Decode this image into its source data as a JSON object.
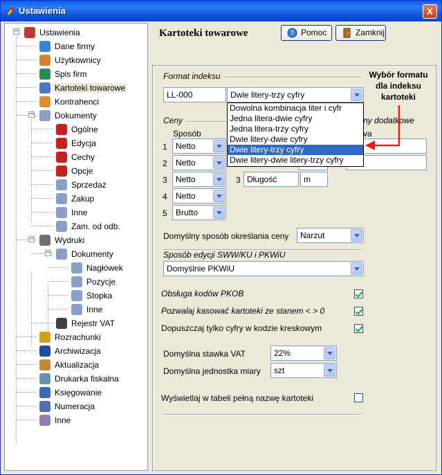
{
  "window": {
    "title": "Ustawienia",
    "close_label": "X"
  },
  "tree": [
    {
      "label": "Ustawienia",
      "icon": "tools-icon"
    },
    {
      "label": "Dane firmy",
      "icon": "building-icon"
    },
    {
      "label": "Użytkownicy",
      "icon": "users-icon"
    },
    {
      "label": "Spis firm",
      "icon": "books-icon"
    },
    {
      "label": "Kartoteki towarowe",
      "icon": "cabinet-icon"
    },
    {
      "label": "Kontrahenci",
      "icon": "handshake-icon"
    },
    {
      "label": "Dokumenty",
      "icon": "documents-icon"
    },
    {
      "label": "Ogólne",
      "icon": "doc-red-icon"
    },
    {
      "label": "Edycja",
      "icon": "doc-red-icon"
    },
    {
      "label": "Cechy",
      "icon": "doc-red-icon"
    },
    {
      "label": "Opcje",
      "icon": "doc-red-icon"
    },
    {
      "label": "Sprzedaż",
      "icon": "documents-icon"
    },
    {
      "label": "Zakup",
      "icon": "documents-icon"
    },
    {
      "label": "Inne",
      "icon": "documents-icon"
    },
    {
      "label": "Zam. od odb.",
      "icon": "documents-icon"
    },
    {
      "label": "Wydruki",
      "icon": "printer-icon"
    },
    {
      "label": "Dokumenty",
      "icon": "documents-icon"
    },
    {
      "label": "Nagłówek",
      "icon": "documents-icon"
    },
    {
      "label": "Pozycje",
      "icon": "documents-icon"
    },
    {
      "label": "Stopka",
      "icon": "documents-icon"
    },
    {
      "label": "Inne",
      "icon": "documents-icon"
    },
    {
      "label": "Rejestr VAT",
      "icon": "vat-icon"
    },
    {
      "label": "Rozrachunki",
      "icon": "money-icon"
    },
    {
      "label": "Archiwizacja",
      "icon": "disk-icon"
    },
    {
      "label": "Aktualizacja",
      "icon": "box-icon"
    },
    {
      "label": "Drukarka fiskalna",
      "icon": "cash-register-icon"
    },
    {
      "label": "Księgowanie",
      "icon": "ledger-icon"
    },
    {
      "label": "Numeracja",
      "icon": "numbering-icon"
    },
    {
      "label": "Inne",
      "icon": "gears-icon"
    }
  ],
  "header": {
    "title": "Kartoteki towarowe",
    "help_label": "Pomoc",
    "close_label": "Zamknij"
  },
  "format": {
    "section_label": "Format indeksu",
    "index_value": "LL-000",
    "selected": "Dwie litery-trzy cyfry",
    "options": [
      "Dowolna kombinacja liter i cyfr",
      "Jedna litera-dwie cyfry",
      "Jedna litera-trzy cyfry",
      "Dwie litery-dwie cyfry",
      "Dwie litery-trzy cyfry",
      "Dwie litery-dwie litery-trzy cyfry"
    ],
    "active_option_index": 4
  },
  "annotation": {
    "line1": "Wybór formatu",
    "line2": "dla indeksu",
    "line3": "kartoteki"
  },
  "prices": {
    "section_label": "Ceny",
    "column_label": "Sposób",
    "rows": [
      {
        "num": "1",
        "value": "Netto"
      },
      {
        "num": "2",
        "value": "Netto"
      },
      {
        "num": "3",
        "value": "Netto"
      },
      {
        "num": "4",
        "value": "Netto"
      },
      {
        "num": "5",
        "value": "Brutto"
      }
    ]
  },
  "extra": {
    "section_label": "ny dodatkowe",
    "column_label": "va",
    "row3_num": "3",
    "row3_name": "Długość",
    "row3_unit": "m"
  },
  "price_method": {
    "label": "Domyślny sposób określania ceny",
    "value": "Narzut"
  },
  "sww": {
    "section_label": "Sposób edycji SWW/KU i PKWiU",
    "value": "Domyślnie PKWiU"
  },
  "checks": [
    {
      "label": "Obsługa kodów PKOB",
      "italic": true,
      "checked": true
    },
    {
      "label": "Pozwalaj kasować kartoteki ze stanem < > 0",
      "italic": true,
      "checked": true
    },
    {
      "label": "Dopuszczaj tylko cyfry w kodzie kreskowym",
      "italic": false,
      "checked": true
    }
  ],
  "vat": {
    "label": "Domyślna stawka VAT",
    "value": "22%"
  },
  "unit": {
    "label": "Domyślna jednostka miary",
    "value": "szt"
  },
  "fullname": {
    "label": "Wyświetlaj w tabeli pełną nazwę kartoteki",
    "checked": false
  },
  "colors": {
    "titlebar": "#0a5fe8",
    "selection": "#316ac5",
    "arrow": "#e02010",
    "check": "#21a121"
  }
}
